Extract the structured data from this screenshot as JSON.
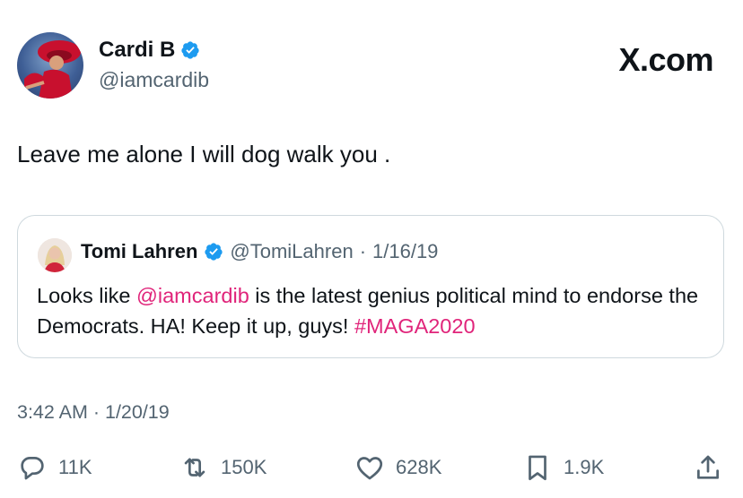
{
  "author": {
    "name": "Cardi B",
    "handle": "@iamcardib",
    "verified": true
  },
  "brand": "X.com",
  "tweet": {
    "text": "Leave me alone I will dog walk you ."
  },
  "quote": {
    "name": "Tomi Lahren",
    "verified": true,
    "handle": "@TomiLahren",
    "separator": "·",
    "date": "1/16/19",
    "text_before": "Looks like ",
    "mention": "@iamcardib",
    "text_after": " is the latest genius political mind to endorse the Democrats. HA! Keep it up, guys! ",
    "hashtag": "#MAGA2020"
  },
  "timestamp": "3:42 AM · 1/20/19",
  "stats": {
    "replies": "11K",
    "retweets": "150K",
    "likes": "628K",
    "bookmarks": "1.9K"
  },
  "colors": {
    "verified_blue": "#1d9bf0",
    "link_pink": "#e0247a",
    "secondary_text": "#536471",
    "border": "#cfd9de"
  },
  "icons": [
    "verified-badge-icon",
    "reply-icon",
    "retweet-icon",
    "like-icon",
    "bookmark-icon",
    "share-icon"
  ]
}
